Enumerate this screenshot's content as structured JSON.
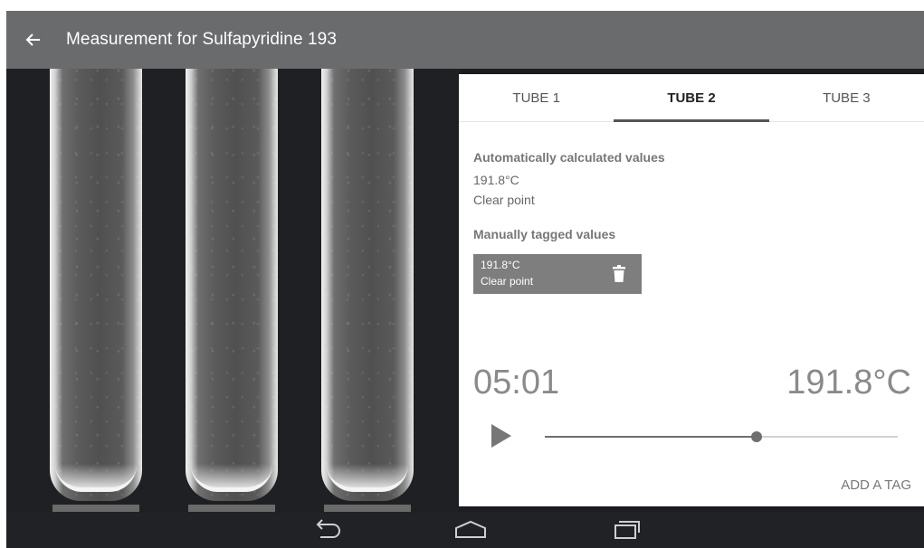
{
  "app_bar": {
    "title": "Measurement for Sulfapyridine 193",
    "back_icon": "arrow-left-icon"
  },
  "tabs": [
    {
      "label": "TUBE 1",
      "active": false
    },
    {
      "label": "TUBE 2",
      "active": true
    },
    {
      "label": "TUBE 3",
      "active": false
    }
  ],
  "auto_values": {
    "heading": "Automatically calculated values",
    "temperature": "191.8°C",
    "event": "Clear point"
  },
  "manual_values": {
    "heading": "Manually tagged values",
    "tags": [
      {
        "temperature": "191.8°C",
        "event": "Clear point",
        "delete_icon": "trash-icon"
      }
    ]
  },
  "player": {
    "time": "05:01",
    "temperature": "191.8°C",
    "play_icon": "play-icon",
    "progress": 0.6
  },
  "actions": {
    "add_tag_label": "ADD A TAG"
  },
  "nav_bar": {
    "icons": [
      "back-nav-icon",
      "home-icon",
      "recents-icon"
    ]
  },
  "colors": {
    "app_bar": "#6a6b6d",
    "tag_chip": "#7e7e7e",
    "accent": "#555555"
  }
}
